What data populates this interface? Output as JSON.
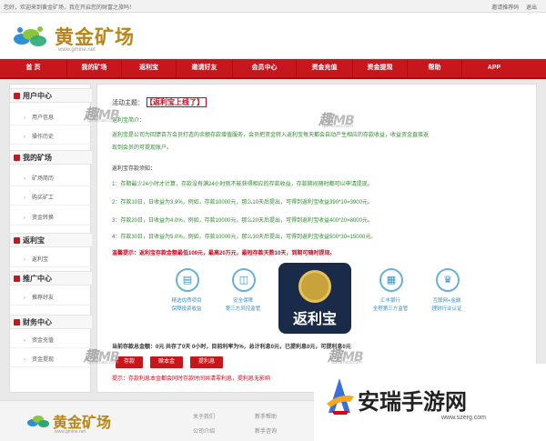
{
  "topbar": {
    "welcome": "您好，欢迎来到黄金矿场，我在开启您的财富之旅吗！",
    "links": [
      "邀请推荐码",
      "退出"
    ]
  },
  "logo": {
    "name": "黄金矿场",
    "url": "www.gmine.net"
  },
  "nav": [
    "首 页",
    "我的矿场",
    "返利宝",
    "邀请好友",
    "会员中心",
    "资金充值",
    "资金提现",
    "帮助",
    "APP"
  ],
  "sidebar": {
    "sections": [
      {
        "title": "用户中心",
        "items": [
          "用户信息",
          "操作历史"
        ]
      },
      {
        "title": "我的矿场",
        "items": [
          "矿场简历",
          "购买矿工",
          "资金转换"
        ]
      },
      {
        "title": "返利宝",
        "items": [
          "返利宝"
        ]
      },
      {
        "title": "推广中心",
        "items": [
          "推荐好友"
        ]
      },
      {
        "title": "财务中心",
        "items": [
          "资金充值",
          "资金提现"
        ]
      }
    ]
  },
  "main": {
    "topic_label": "活动主题：",
    "topic_highlight": "【返利宝上线了】",
    "intro_label": "返利宝简介：",
    "intro_1": "返利宝是公司为回馈百万会员打造的余额存款增值服务，会员把资金转入返利宝每天都会自动产生相应的存款收益，收益资金直接返",
    "intro_2": "现到会员的可提现账户。",
    "rules_label": "返利宝存款须知：",
    "rule_1": "1：存期最少24小时才计算，存款没有满24小时就不能获得相应的存款收益，存款期间随时都可以申请提现。",
    "rule_2": "2：存款10日，日收益为3.9%，例如，存款10000元，那么10天后提出，可得到返利宝收益390*10=3900元。",
    "rule_3": "3：存款20日，日收益为4.0%，例如，存款10000元，那么20天后提出，可得到返利宝收益400*20=8000元。",
    "rule_4": "4：存款30日，日收益为5.0%，例如，存款10000元，那么30天后提出，可得到返利宝收益500*30=15000元。",
    "warn": "温馨提示：返利宝存款金额最低100元，最高20万元，最短存款天数10天，到期可随时提现。",
    "features": [
      {
        "icon": "document-icon",
        "label": "精选优质项目\n保障投资收益"
      },
      {
        "icon": "vr-icon",
        "label": "安全保障\n第三方风控监管"
      },
      {
        "icon": "cylinder-icon",
        "label": ""
      },
      {
        "icon": "bank-icon",
        "label": "汇丰银行\n全程第三方监管"
      },
      {
        "icon": "trophy-icon",
        "label": "互联网+金融\n理财行业认证"
      }
    ],
    "stats": "当前存款总金额：0元 共存了0天 0小时，目前利率为%，总计利息0元，已提利息0元，可提利息0元",
    "buttons": [
      "存款",
      "赎本金",
      "提利息"
    ],
    "note": "提示：存款利息本金都会同时存款时间共清零利息，提利息无影响"
  },
  "footer": {
    "logo_name": "黄金矿场",
    "logo_url": "www.gmine.net",
    "links": [
      "关于我们",
      "公司介绍",
      "新手帮助",
      "新手咨询"
    ]
  },
  "watermark": {
    "text": "趣",
    "brand": "MB",
    "url": "qunehao.com"
  },
  "app_badge": {
    "text": "返利宝"
  },
  "site_badge": {
    "text": "安瑞手游网",
    "url": "www.szerg.com"
  },
  "colors": {
    "nav_red": "#c8161d",
    "gold": "#b98516",
    "green": "#2e8b2e",
    "accent_blue": "#3a8fc3"
  }
}
